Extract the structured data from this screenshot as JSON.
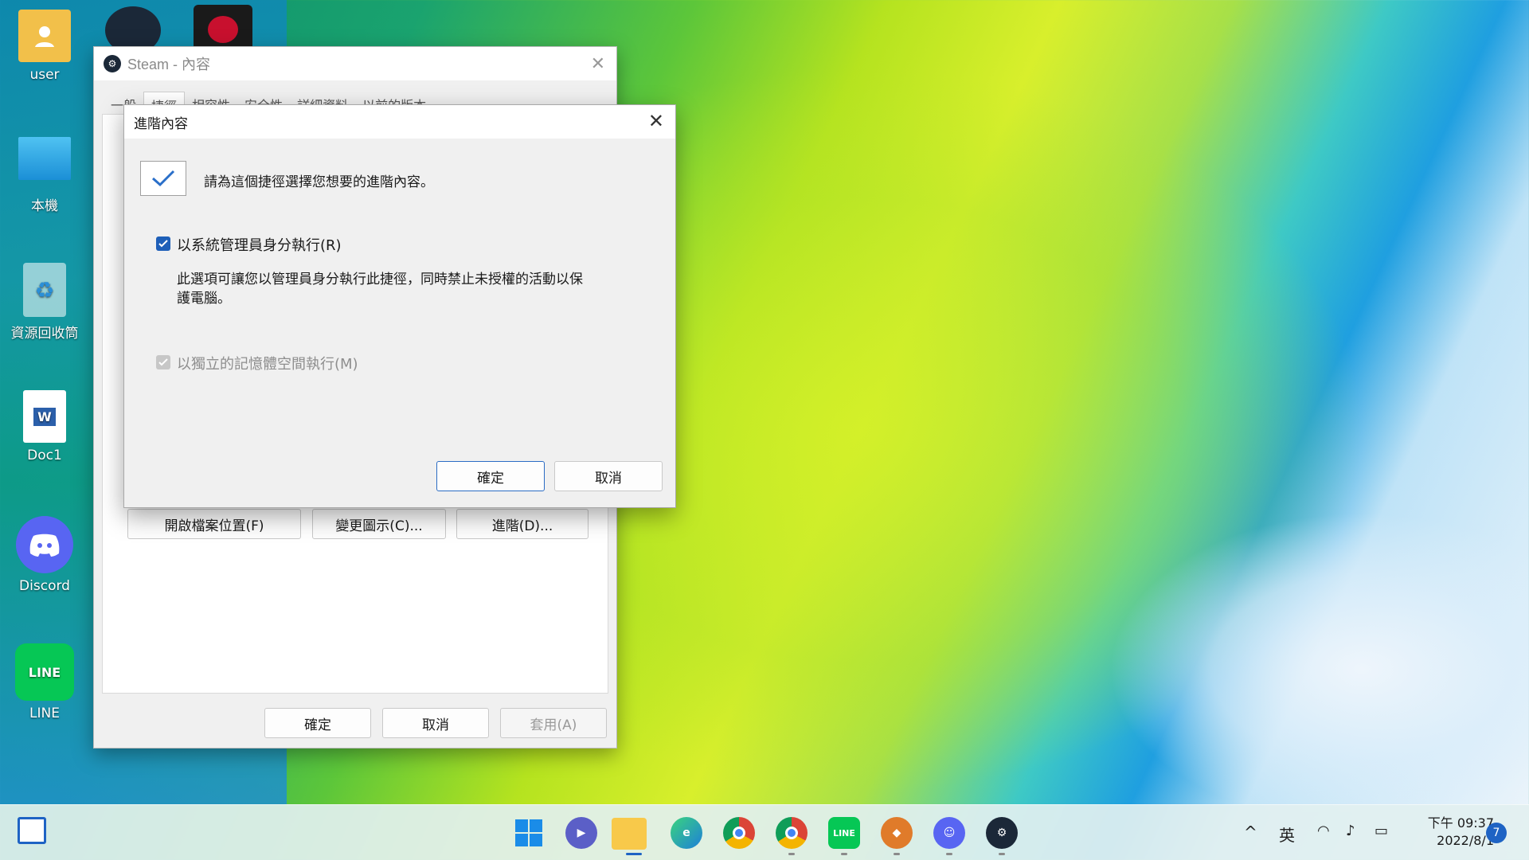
{
  "desktop": {
    "icons": [
      {
        "label": "user"
      },
      {
        "label": "本機"
      },
      {
        "label": "資源回收筒"
      },
      {
        "label": "Doc1"
      },
      {
        "label": "Discord"
      },
      {
        "label": "LINE"
      }
    ]
  },
  "steam_window": {
    "title": "Steam - 內容",
    "tabs": [
      "一般",
      "捷徑",
      "相容性",
      "安全性",
      "詳細資料",
      "以前的版本"
    ],
    "buttons": {
      "open_location": "開啟檔案位置(F)",
      "change_icon": "變更圖示(C)...",
      "advanced": "進階(D)...",
      "ok": "確定",
      "cancel": "取消",
      "apply": "套用(A)"
    }
  },
  "advanced_dialog": {
    "title": "進階內容",
    "intro": "請為這個捷徑選擇您想要的進階內容。",
    "run_as_admin": {
      "label": "以系統管理員身分執行(R)",
      "checked": true,
      "description_line1": "此選項可讓您以管理員身分執行此捷徑，同時禁止未授權的活動以保",
      "description_line2": "護電腦。"
    },
    "separate_memory": {
      "label": "以獨立的記憶體空間執行(M)",
      "checked": true,
      "enabled": false
    },
    "ok": "確定",
    "cancel": "取消"
  },
  "taskbar": {
    "apps": [
      "start",
      "teams-chat",
      "file-explorer",
      "edge",
      "chrome",
      "chrome-alt",
      "line",
      "game",
      "discord",
      "steam"
    ],
    "tray": {
      "language": "英",
      "time": "下午 09:37",
      "date": "2022/8/1",
      "notifications": "7"
    }
  },
  "colors": {
    "accent": "#1e5fb8",
    "dialog_bg": "#f0f0f0",
    "taskbar_bg": "#e2f0f0"
  }
}
